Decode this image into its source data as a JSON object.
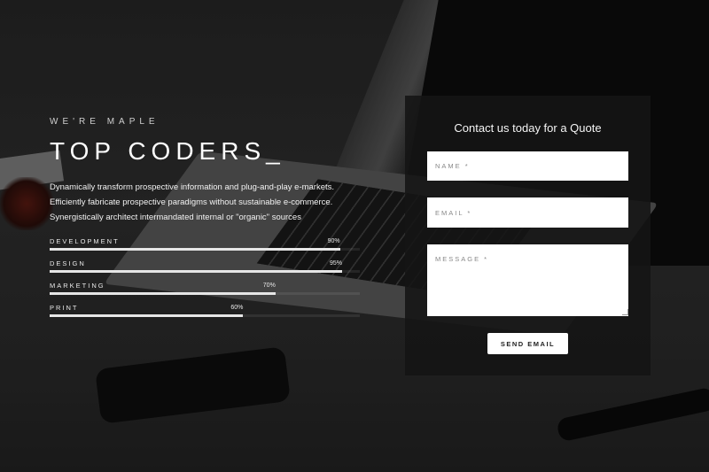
{
  "hero": {
    "eyebrow": "WE'RE MAPLE",
    "title": "TOP CODERS_",
    "description": [
      "Dynamically transform prospective information and plug-and-play e-markets.",
      "Efficiently fabricate prospective paradigms without sustainable e-commerce.",
      "Synergistically architect intermandated internal or \"organic\" sources"
    ]
  },
  "skills": [
    {
      "label": "DEVELOPMENT",
      "percent": 90,
      "percent_text": "90%"
    },
    {
      "label": "DESIGN",
      "percent": 95,
      "percent_text": "95%"
    },
    {
      "label": "MARKETING",
      "percent": 70,
      "percent_text": "70%"
    },
    {
      "label": "PRINT",
      "percent": 60,
      "percent_text": "60%"
    }
  ],
  "contact": {
    "heading": "Contact us today for a Quote",
    "name_placeholder": "NAME *",
    "email_placeholder": "EMAIL *",
    "message_placeholder": "MESSAGE *",
    "submit_label": "SEND EMAIL"
  }
}
